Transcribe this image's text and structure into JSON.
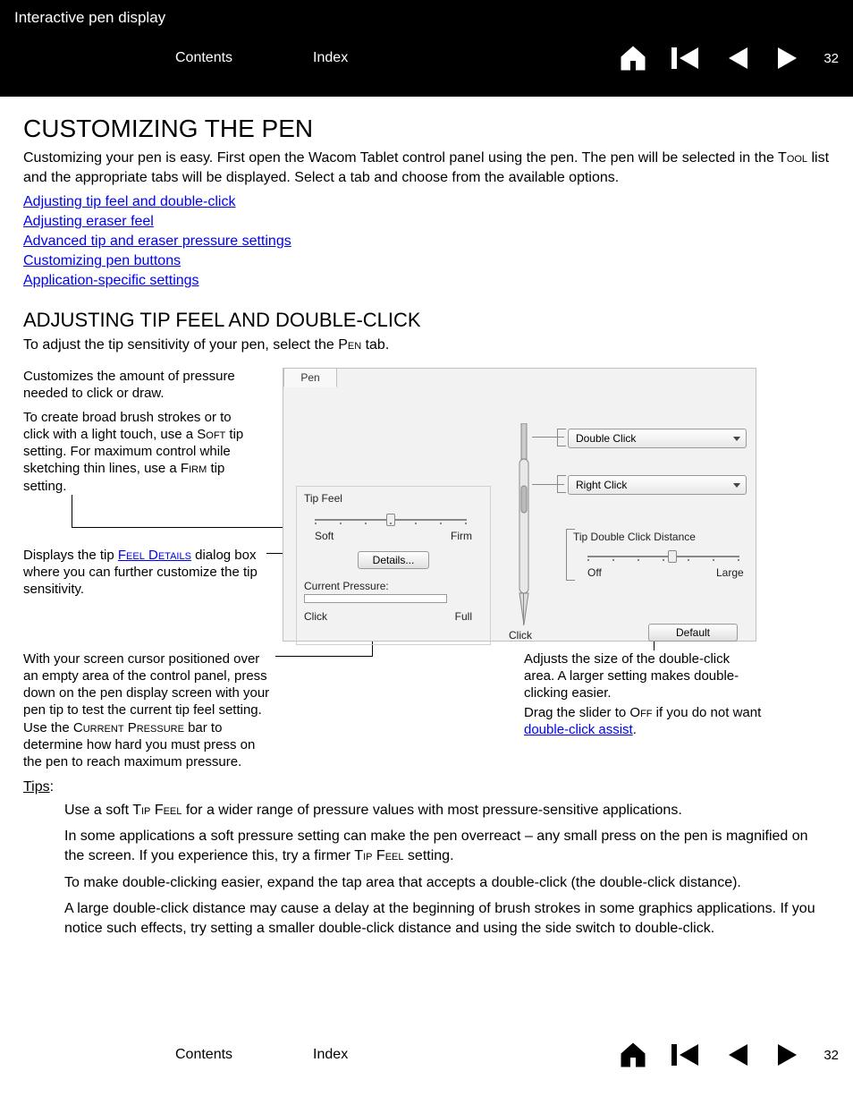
{
  "header": {
    "title": "Interactive pen display",
    "contents": "Contents",
    "index": "Index",
    "page": "32"
  },
  "main": {
    "h1": "CUSTOMIZING THE PEN",
    "intro_a": "Customizing your pen is easy.  First open the Wacom Tablet control panel using the pen.  The pen will be selected in the T",
    "intro_tool": "ool",
    "intro_b": " list and the appropriate tabs will be displayed.  Select a tab and choose from the available options.",
    "links": [
      "Adjusting tip feel and double-click",
      "Adjusting eraser feel",
      "Advanced tip and eraser pressure settings",
      "Customizing pen buttons",
      "Application-specific settings"
    ],
    "h2": "ADJUSTING TIP FEEL AND DOUBLE-CLICK",
    "h2sub_a": "To adjust the tip sensitivity of your pen, select the P",
    "h2sub_pen": "en",
    "h2sub_b": " tab."
  },
  "callouts": {
    "c1": "Customizes the amount of pressure needed to click or draw.",
    "c2a": "To create broad brush strokes or to click with a light touch, use a S",
    "c2soft": "oft",
    "c2b": " tip setting.  For maximum control while sketching thin lines, use a F",
    "c2firm": "irm",
    "c2c": " tip setting.",
    "c3a": "Displays the tip ",
    "c3link": "Feel Details",
    "c3b": " dialog box where you can further customize the tip sensitivity.",
    "c4a": "With your screen cursor positioned over an empty area of the control panel, press down on the pen display screen with your pen tip to test the current tip feel setting.  Use the C",
    "c4cur": "urrent",
    "c4sp": " P",
    "c4pres": "ressure",
    "c4b": " bar to determine how hard you must press on the pen to reach maximum pressure.",
    "c5": "Adjusts the size of the double-click area.  A larger setting makes double-clicking easier.",
    "c6a": "Drag the slider to O",
    "c6off": "ff",
    "c6b": " if you do not want ",
    "c6link": "double-click assist",
    "c6c": "."
  },
  "panel": {
    "tab": "Pen",
    "tipfeel": "Tip Feel",
    "soft": "Soft",
    "firm": "Firm",
    "details": "Details...",
    "curpres": "Current Pressure:",
    "click": "Click",
    "full": "Full",
    "penclick": "Click",
    "dd1": "Double Click",
    "dd2": "Right Click",
    "tipdcd": "Tip Double Click Distance",
    "off": "Off",
    "large": "Large",
    "default": "Default"
  },
  "tips": {
    "label": "Tips",
    "t1a": "Use a soft T",
    "t1tf": "ip",
    "t1sp": " F",
    "t1eel": "eel",
    "t1b": " for a wider range of pressure values with most pressure-sensitive applications.",
    "t2a": "In some applications a soft pressure setting can make the pen overreact – any small press on the pen is magnified on the screen.  If you experience this, try a firmer T",
    "t2tf": "ip",
    "t2sp": " F",
    "t2eel": "eel",
    "t2b": " setting.",
    "t3": "To make double-clicking easier, expand the tap area that accepts a double-click (the double-click distance).",
    "t4": "A large double-click distance may cause a delay at the beginning of brush strokes in some graphics applications.  If you notice such effects, try setting a smaller double-click distance and using the side switch to double-click."
  },
  "footer": {
    "contents": "Contents",
    "index": "Index",
    "page": "32"
  }
}
